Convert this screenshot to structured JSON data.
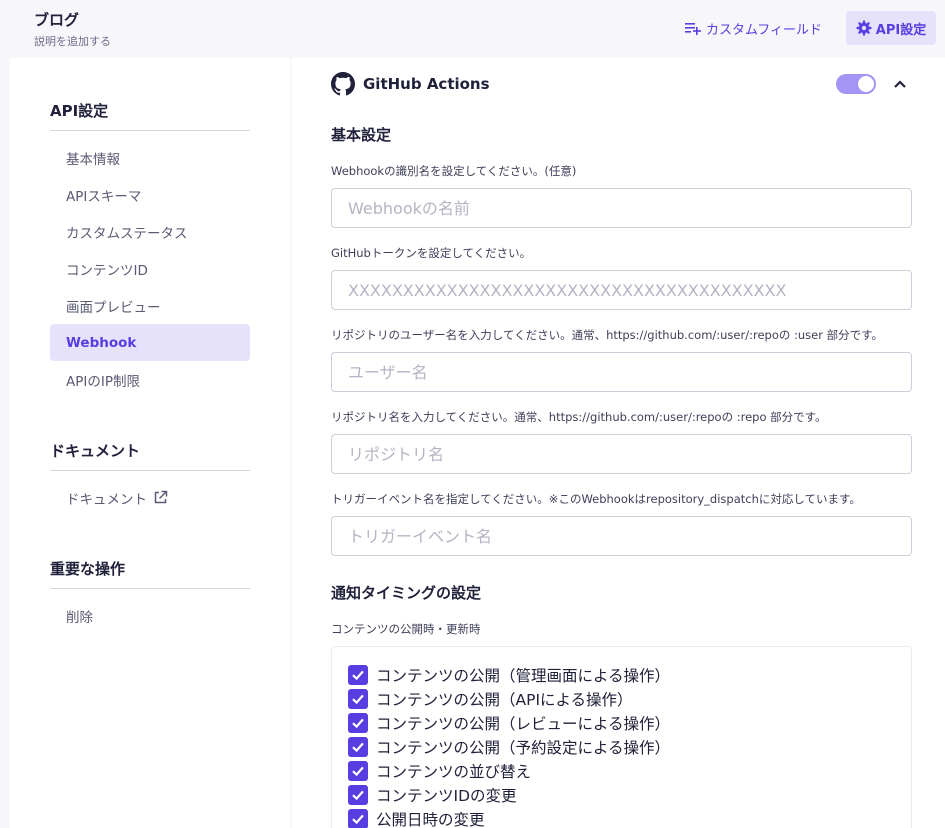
{
  "header": {
    "title": "ブログ",
    "subtitle": "説明を追加する",
    "custom_fields_label": "カスタムフィールド",
    "api_settings_label": "API設定"
  },
  "sidebar": {
    "api_section_title": "API設定",
    "items": [
      {
        "label": "基本情報"
      },
      {
        "label": "APIスキーマ"
      },
      {
        "label": "カスタムステータス"
      },
      {
        "label": "コンテンツID"
      },
      {
        "label": "画面プレビュー"
      },
      {
        "label": "Webhook",
        "active": true
      },
      {
        "label": "APIのIP制限"
      }
    ],
    "docs_section_title": "ドキュメント",
    "docs_item_label": "ドキュメント",
    "danger_section_title": "重要な操作",
    "delete_label": "削除"
  },
  "main": {
    "integration_title": "GitHub Actions",
    "enabled": true,
    "basic_section_title": "基本設定",
    "fields": [
      {
        "label": "Webhookの識別名を設定してください。(任意)",
        "placeholder": "Webhookの名前",
        "value": ""
      },
      {
        "label": "GitHubトークンを設定してください。",
        "placeholder": "XXXXXXXXXXXXXXXXXXXXXXXXXXXXXXXXXXXXXXXX",
        "value": ""
      },
      {
        "label": "リポジトリのユーザー名を入力してください。通常、https://github.com/:user/:repoの :user 部分です。",
        "placeholder": "ユーザー名",
        "value": ""
      },
      {
        "label": "リポジトリ名を入力してください。通常、https://github.com/:user/:repoの :repo 部分です。",
        "placeholder": "リポジトリ名",
        "value": ""
      },
      {
        "label": "トリガーイベント名を指定してください。※このWebhookはrepository_dispatchに対応しています。",
        "placeholder": "トリガーイベント名",
        "value": ""
      }
    ],
    "timing_section_title": "通知タイミングの設定",
    "timing_group_label": "コンテンツの公開時・更新時",
    "checkboxes": [
      {
        "label": "コンテンツの公開（管理画面による操作）",
        "checked": true
      },
      {
        "label": "コンテンツの公開（APIによる操作）",
        "checked": true
      },
      {
        "label": "コンテンツの公開（レビューによる操作）",
        "checked": true
      },
      {
        "label": "コンテンツの公開（予約設定による操作）",
        "checked": true
      },
      {
        "label": "コンテンツの並び替え",
        "checked": true
      },
      {
        "label": "コンテンツIDの変更",
        "checked": true
      },
      {
        "label": "公開日時の変更",
        "checked": true
      }
    ]
  },
  "colors": {
    "accent": "#563ee0",
    "accent_light": "#e6e2fc",
    "toggle_on": "#a494f3"
  }
}
